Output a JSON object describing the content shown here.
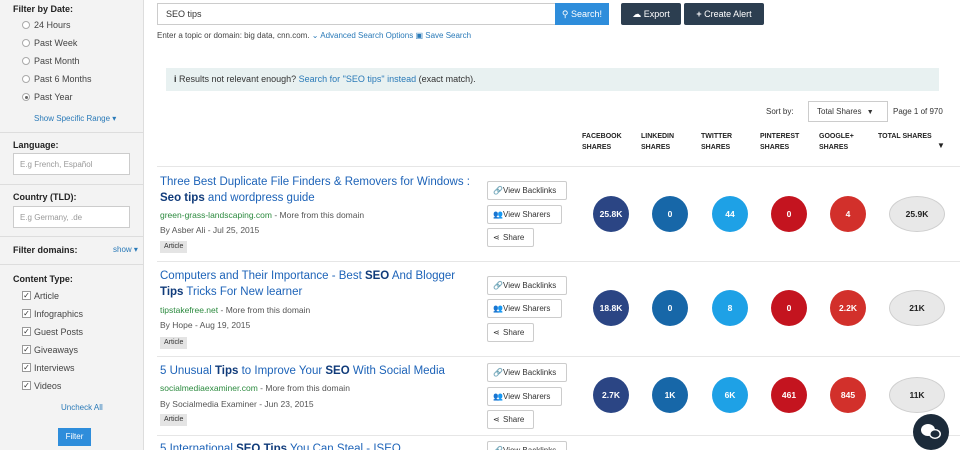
{
  "sidebar": {
    "filter_by_date": "Filter by Date:",
    "date_options": [
      {
        "label": "24 Hours",
        "selected": false
      },
      {
        "label": "Past Week",
        "selected": false
      },
      {
        "label": "Past Month",
        "selected": false
      },
      {
        "label": "Past 6 Months",
        "selected": false
      },
      {
        "label": "Past Year",
        "selected": true
      }
    ],
    "specific_range": "Show Specific Range ▾",
    "language_label": "Language:",
    "language_placeholder": "E.g French, Español",
    "country_label": "Country (TLD):",
    "country_placeholder": "E.g Germany, .de",
    "filter_domains": "Filter domains:",
    "show_link": "show ▾",
    "content_type": "Content Type:",
    "content_types": [
      {
        "label": "Article",
        "checked": true
      },
      {
        "label": "Infographics",
        "checked": true
      },
      {
        "label": "Guest Posts",
        "checked": true
      },
      {
        "label": "Giveaways",
        "checked": true
      },
      {
        "label": "Interviews",
        "checked": true
      },
      {
        "label": "Videos",
        "checked": true
      }
    ],
    "uncheck_all": "Uncheck All",
    "filter_button": "Filter"
  },
  "search": {
    "value": "SEO tips",
    "button": "Search!",
    "export": "Export",
    "create_alert": "Create Alert",
    "helper_text": "Enter a topic or domain: big data, cnn.com.",
    "advanced": "Advanced Search Options",
    "save": "Save Search"
  },
  "notice": {
    "text": "Results not relevant enough?",
    "link": "Search for \"SEO tips\" instead",
    "suffix": "(exact match)."
  },
  "sort": {
    "label": "Sort by:",
    "value": "Total Shares",
    "page_info": "Page 1 of 970"
  },
  "columns": {
    "facebook": "FACEBOOK SHARES",
    "linkedin": "LINKEDIN SHARES",
    "twitter": "TWITTER SHARES",
    "pinterest": "PINTEREST SHARES",
    "googleplus": "GOOGLE+ SHARES",
    "total": "TOTAL SHARES"
  },
  "actions": {
    "backlinks": "View Backlinks",
    "sharers": "View Sharers",
    "share": "Share"
  },
  "colors": {
    "facebook": "#2b4584",
    "linkedin": "#1767a8",
    "twitter": "#1ea1e6",
    "pinterest": "#c4141f",
    "googleplus": "#d2302b"
  },
  "results": [
    {
      "title_html": "Three Best Duplicate File Finders & Removers for Windows : <b>Seo tips</b> and wordpress guide",
      "domain": "green-grass-landscaping.com",
      "more": "- More from this domain",
      "meta": "By Asber Ali - Jul 25, 2015",
      "tag": "Article",
      "facebook": "25.8K",
      "linkedin": "0",
      "twitter": "44",
      "pinterest": "0",
      "googleplus": "4",
      "total": "25.9K"
    },
    {
      "title_html": "Computers and Their Importance - Best <b>SEO</b> And Blogger <b>Tips</b> Tricks For New learner",
      "domain": "tipstakefree.net",
      "more": "- More from this domain",
      "meta": "By Hope - Aug 19, 2015",
      "tag": "Article",
      "facebook": "18.8K",
      "linkedin": "0",
      "twitter": "8",
      "pinterest": "0",
      "googleplus": "2.2K",
      "total": "21K"
    },
    {
      "title_html": "5 Unusual <b>Tips</b> to Improve Your <b>SEO</b> With Social Media",
      "domain": "socialmediaexaminer.com",
      "more": "- More from this domain",
      "meta": "By Socialmedia Examiner - Jun 23, 2015",
      "tag": "Article",
      "facebook": "2.7K",
      "linkedin": "1K",
      "twitter": "6K",
      "pinterest": "461",
      "googleplus": "845",
      "total": "11K"
    },
    {
      "title_html": "5 International <b>SEO Tips</b> You Can Steal - ISEO",
      "domain": "",
      "more": "",
      "meta": "",
      "tag": "",
      "facebook": "",
      "linkedin": "",
      "twitter": "",
      "pinterest": "",
      "googleplus": "",
      "total": ""
    }
  ]
}
